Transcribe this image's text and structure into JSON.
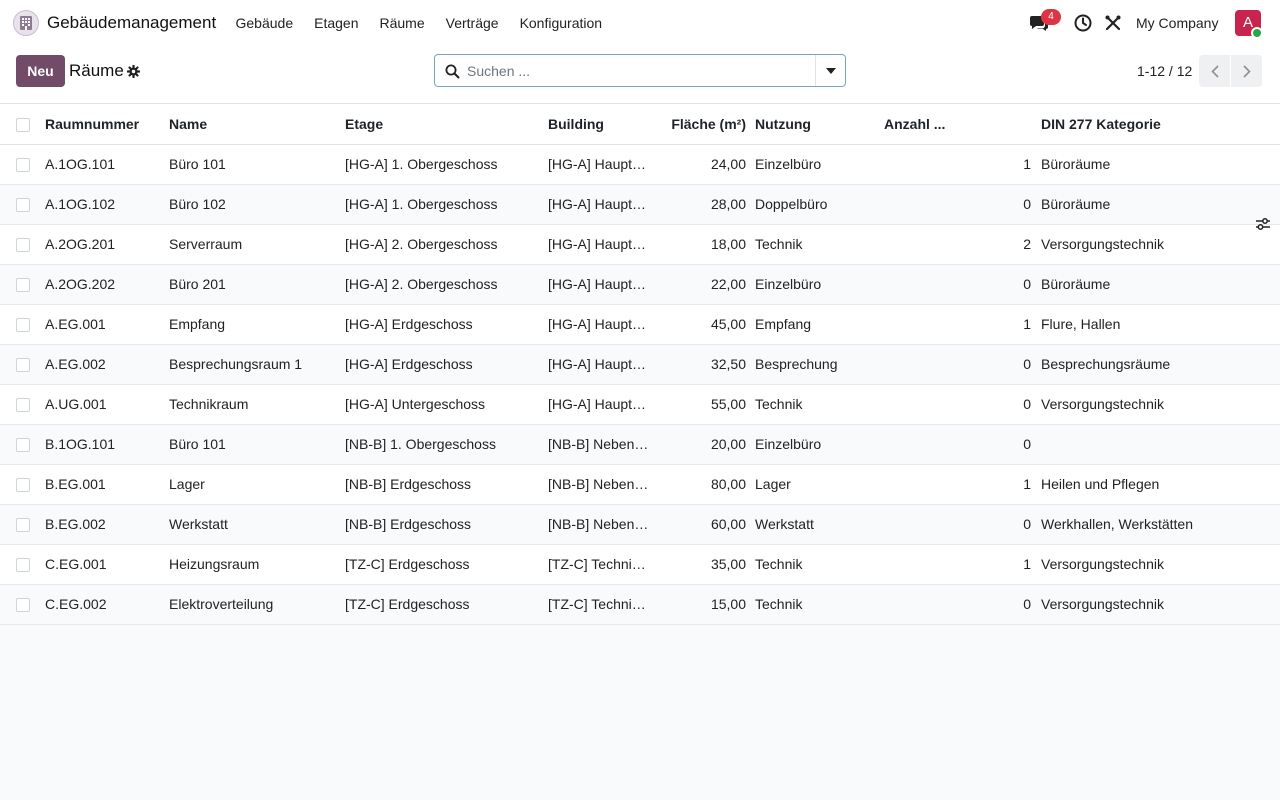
{
  "navbar": {
    "app_name": "Gebäudemanagement",
    "menu": [
      "Gebäude",
      "Etagen",
      "Räume",
      "Verträge",
      "Konfiguration"
    ],
    "messages_badge": "4",
    "company": "My Company",
    "avatar_letter": "A"
  },
  "control": {
    "new_label": "Neu",
    "title": "Räume",
    "search_placeholder": "Suchen ...",
    "pager": "1-12 / 12"
  },
  "table": {
    "columns": [
      "Raumnummer",
      "Name",
      "Etage",
      "Building",
      "Fläche (m²)",
      "Nutzung",
      "Anzahl ...",
      "DIN 277 Kategorie"
    ],
    "rows": [
      [
        "A.1OG.101",
        "Büro 101",
        "[HG-A] 1. Obergeschoss",
        "[HG-A] Hauptgebäude A",
        "24,00",
        "Einzelbüro",
        "1",
        "Büroräume"
      ],
      [
        "A.1OG.102",
        "Büro 102",
        "[HG-A] 1. Obergeschoss",
        "[HG-A] Hauptgebäude A",
        "28,00",
        "Doppelbüro",
        "0",
        "Büroräume"
      ],
      [
        "A.2OG.201",
        "Serverraum",
        "[HG-A] 2. Obergeschoss",
        "[HG-A] Hauptgebäude A",
        "18,00",
        "Technik",
        "2",
        "Versorgungstechnik"
      ],
      [
        "A.2OG.202",
        "Büro 201",
        "[HG-A] 2. Obergeschoss",
        "[HG-A] Hauptgebäude A",
        "22,00",
        "Einzelbüro",
        "0",
        "Büroräume"
      ],
      [
        "A.EG.001",
        "Empfang",
        "[HG-A] Erdgeschoss",
        "[HG-A] Hauptgebäude A",
        "45,00",
        "Empfang",
        "1",
        "Flure, Hallen"
      ],
      [
        "A.EG.002",
        "Besprechungsraum 1",
        "[HG-A] Erdgeschoss",
        "[HG-A] Hauptgebäude A",
        "32,50",
        "Besprechung",
        "0",
        "Besprechungsräume"
      ],
      [
        "A.UG.001",
        "Technikraum",
        "[HG-A] Untergeschoss",
        "[HG-A] Hauptgebäude A",
        "55,00",
        "Technik",
        "0",
        "Versorgungstechnik"
      ],
      [
        "B.1OG.101",
        "Büro 101",
        "[NB-B] 1. Obergeschoss",
        "[NB-B] Nebengebäude B",
        "20,00",
        "Einzelbüro",
        "0",
        ""
      ],
      [
        "B.EG.001",
        "Lager",
        "[NB-B] Erdgeschoss",
        "[NB-B] Nebengebäude B",
        "80,00",
        "Lager",
        "1",
        "Heilen und Pflegen"
      ],
      [
        "B.EG.002",
        "Werkstatt",
        "[NB-B] Erdgeschoss",
        "[NB-B] Nebengebäude B",
        "60,00",
        "Werkstatt",
        "0",
        "Werkhallen, Werkstätten"
      ],
      [
        "C.EG.001",
        "Heizungsraum",
        "[TZ-C] Erdgeschoss",
        "[TZ-C] Technikzentrale C",
        "35,00",
        "Technik",
        "1",
        "Versorgungstechnik"
      ],
      [
        "C.EG.002",
        "Elektroverteilung",
        "[TZ-C] Erdgeschoss",
        "[TZ-C] Technikzentrale C",
        "15,00",
        "Technik",
        "0",
        "Versorgungstechnik"
      ]
    ]
  },
  "colors": {
    "brand": "#714b67",
    "badge": "#dc3545",
    "avatar": "#c7254e",
    "presence": "#28a745"
  }
}
